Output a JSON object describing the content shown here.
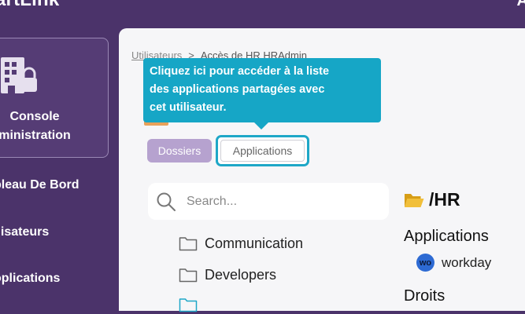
{
  "app": {
    "brand": "artLink",
    "corner_glyph": "A"
  },
  "sidebar": {
    "card": {
      "icon": "building-icon",
      "label_line1": "Console",
      "label_line2": "ministration"
    },
    "items": [
      {
        "label": "bleau De Bord"
      },
      {
        "label": "ilisateurs"
      },
      {
        "label": "oplications"
      }
    ]
  },
  "breadcrumb": {
    "parent": "Utilisateurs",
    "separator": ">",
    "current": "Accès de HR HRAdmin"
  },
  "tooltip": {
    "line1": "Cliquez ici pour accéder à la liste",
    "line2": "des applications partagées avec",
    "line3": "cet utilisateur."
  },
  "tabs": {
    "dossiers": "Dossiers",
    "applications": "Applications"
  },
  "search": {
    "placeholder": "Search..."
  },
  "folders": [
    {
      "name": "Communication",
      "icon": "folder-icon"
    },
    {
      "name": "Developers",
      "icon": "folder-icon"
    }
  ],
  "detail": {
    "path": "/HR",
    "path_icon": "open-folder-icon",
    "apps_heading": "Applications",
    "apps": [
      {
        "logo_text": "wo",
        "name": "workday"
      }
    ],
    "rights_heading": "Droits"
  },
  "colors": {
    "sidebar_bg": "#4b336a",
    "accent_teal": "#16a6c6",
    "tab_purple": "#b6a2cf",
    "folder_yellow": "#e6b325",
    "workday_blue": "#2d6ad3"
  }
}
